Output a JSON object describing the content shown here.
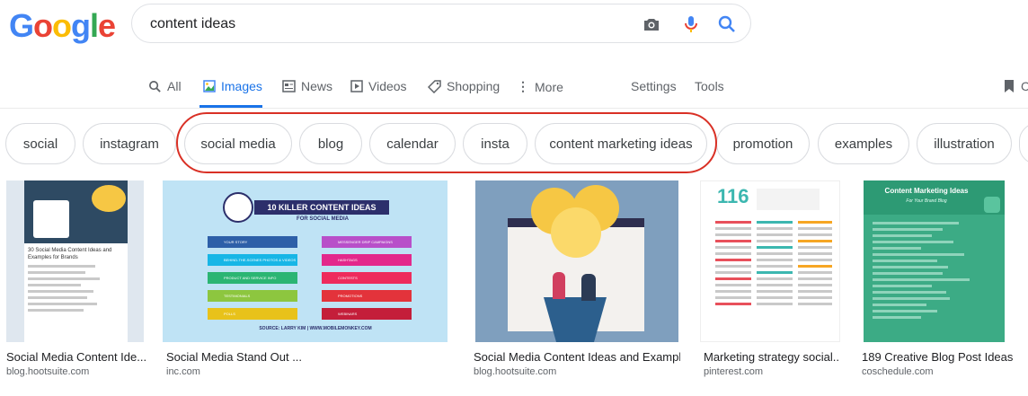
{
  "logo": [
    "G",
    "o",
    "o",
    "g",
    "l",
    "e"
  ],
  "search": {
    "query": "content ideas"
  },
  "nav": {
    "tabs": [
      "All",
      "Images",
      "News",
      "Videos",
      "Shopping",
      "More"
    ],
    "settings": "Settings",
    "tools": "Tools"
  },
  "chips": [
    "social",
    "instagram",
    "social media",
    "blog",
    "calendar",
    "insta",
    "content marketing ideas",
    "promotion",
    "examples",
    "illustration"
  ],
  "results": [
    {
      "title": "Social Media Content Ide...",
      "source": "blog.hootsuite.com",
      "thumb_title": "30 Social Media Content Ideas and Examples for Brands"
    },
    {
      "title": "Social Media Stand Out ...",
      "source": "inc.com",
      "thumb_title": "10 KILLER CONTENT IDEAS",
      "thumb_sub": "FOR SOCIAL MEDIA",
      "thumb_items": [
        "YOUR STORY",
        "BEHIND-THE-SCENES PHOTOS & VIDEOS",
        "PRODUCT AND SERVICE INFO",
        "TESTIMONIALS",
        "POLLS",
        "MESSENGER DRIP CAMPAIGNS",
        "HASHTAGS",
        "CONTESTS",
        "PROMOTIONS",
        "WEBINARS"
      ],
      "thumb_footer": "SOURCE: LARRY KIM | WWW.MOBILEMONKEY.COM"
    },
    {
      "title": "Social Media Content Ideas and Exampl...",
      "source": "blog.hootsuite.com"
    },
    {
      "title": "Marketing strategy social...",
      "source": "pinterest.com",
      "thumb_num": "116"
    },
    {
      "title": "189 Creative Blog Post Ideas ...",
      "source": "coschedule.com",
      "thumb_title": "Content Marketing Ideas",
      "thumb_sub": "For Your Brand Blog"
    }
  ],
  "colors": {
    "blue": "#4285F4",
    "red": "#EA4335",
    "yellow": "#FBBC05",
    "green": "#34A853",
    "accent": "#1a73e8"
  }
}
